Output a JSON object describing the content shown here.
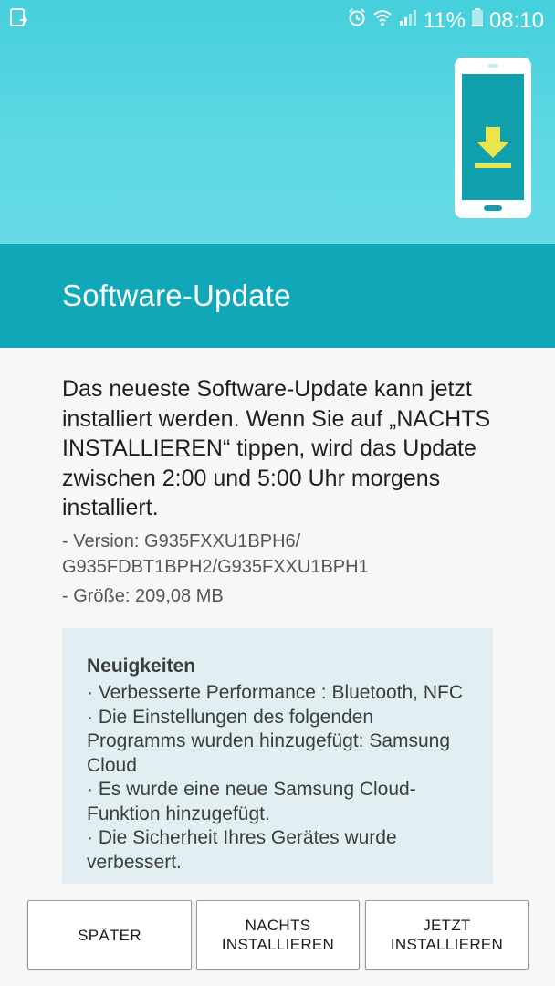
{
  "status_bar": {
    "battery_percent": "11%",
    "time": "08:10",
    "icons": [
      "download-notification-icon",
      "alarm-icon",
      "wifi-icon",
      "signal-icon",
      "battery-icon"
    ]
  },
  "header": {
    "title": "Software-Update",
    "illustration": "phone-download-icon"
  },
  "main": {
    "description": "Das neueste Software-Update kann jetzt installiert werden. Wenn Sie auf „NACHTS INSTALLIEREN“ tippen, wird das Update zwischen 2:00 und 5:00 Uhr morgens installiert.",
    "version_line_1": " - Version: G935FXXU1BPH6/",
    "version_line_2": "G935FDBT1BPH2/G935FXXU1BPH1",
    "size_line": " - Größe: 209,08 MB"
  },
  "news": {
    "title": "Neuigkeiten",
    "items": [
      "· Verbesserte Performance : Bluetooth, NFC",
      "· Die Einstellungen des folgenden Programms wurden hinzugefügt: Samsung Cloud",
      "· Es wurde eine neue Samsung Cloud-Funktion hinzugefügt.",
      "· Die Sicherheit Ihres Gerätes wurde verbessert."
    ]
  },
  "buttons": {
    "later": "SPÄTER",
    "night": "NACHTS\nINSTALLIEREN",
    "now": "JETZT\nINSTALLIEREN"
  },
  "colors": {
    "hero": "#5ed9e4",
    "title_band": "#10a7b8",
    "news_bg": "#e1eff2",
    "accent_yellow": "#e8e64a"
  }
}
